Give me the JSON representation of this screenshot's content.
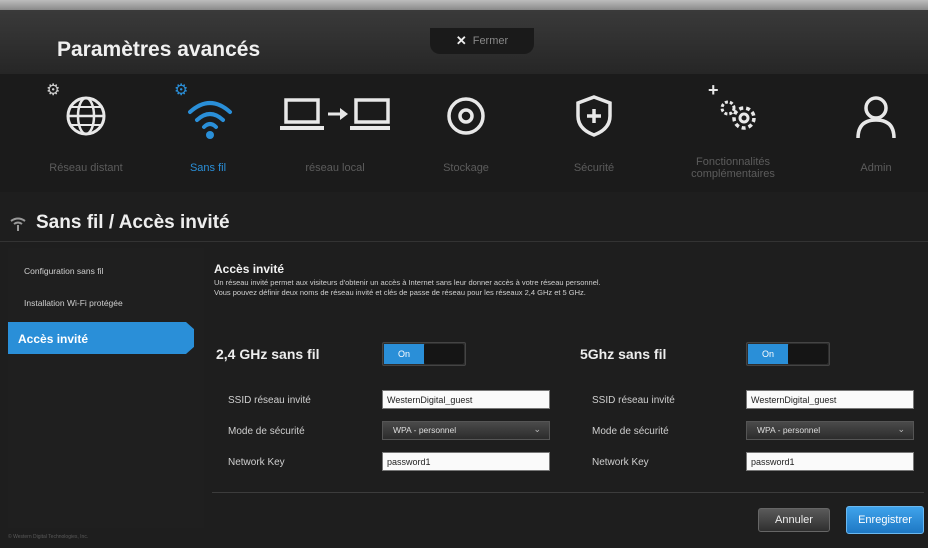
{
  "header": {
    "title": "Paramètres avancés",
    "close_label": "Fermer"
  },
  "nav": [
    {
      "label": "Réseau distant",
      "icon": "globe-icon"
    },
    {
      "label": "Sans fil",
      "icon": "wifi-icon"
    },
    {
      "label": "réseau local",
      "icon": "network-icon"
    },
    {
      "label": "Stockage",
      "icon": "disk-icon"
    },
    {
      "label": "Sécurité",
      "icon": "shield-icon"
    },
    {
      "label": "Fonctionnalités complémentaires",
      "icon": "gears-icon"
    },
    {
      "label": "Admin",
      "icon": "user-icon"
    }
  ],
  "section": {
    "title": "Sans fil / Accès invité"
  },
  "sidebar": {
    "items": [
      {
        "label": "Configuration sans fil"
      },
      {
        "label": "Installation Wi-Fi protégée"
      },
      {
        "label": "Accès invité"
      }
    ]
  },
  "guest": {
    "title": "Accès invité",
    "desc_line1": "Un réseau invité permet aux visiteurs d'obtenir un accès à Internet sans leur donner accès à votre réseau personnel.",
    "desc_line2": "Vous pouvez définir deux noms de réseau invité et clés de passe de réseau pour les réseaux 2,4 GHz et 5 GHz."
  },
  "band24": {
    "title": "2,4 GHz sans fil",
    "toggle": "On",
    "ssid_label": "SSID réseau invité",
    "ssid_value": "WesternDigital_guest",
    "mode_label": "Mode de sécurité",
    "mode_value": "WPA - personnel",
    "key_label": "Network Key",
    "key_value": "password1"
  },
  "band5": {
    "title": "5Ghz sans fil",
    "toggle": "On",
    "ssid_label": "SSID réseau invité",
    "ssid_value": "WesternDigital_guest",
    "mode_label": "Mode de sécurité",
    "mode_value": "WPA - personnel",
    "key_label": "Network Key",
    "key_value": "password1"
  },
  "buttons": {
    "cancel": "Annuler",
    "save": "Enregistrer"
  },
  "footer": {
    "copyright": "© Western Digital Technologies, Inc."
  },
  "colors": {
    "accent": "#2a8fd8"
  }
}
